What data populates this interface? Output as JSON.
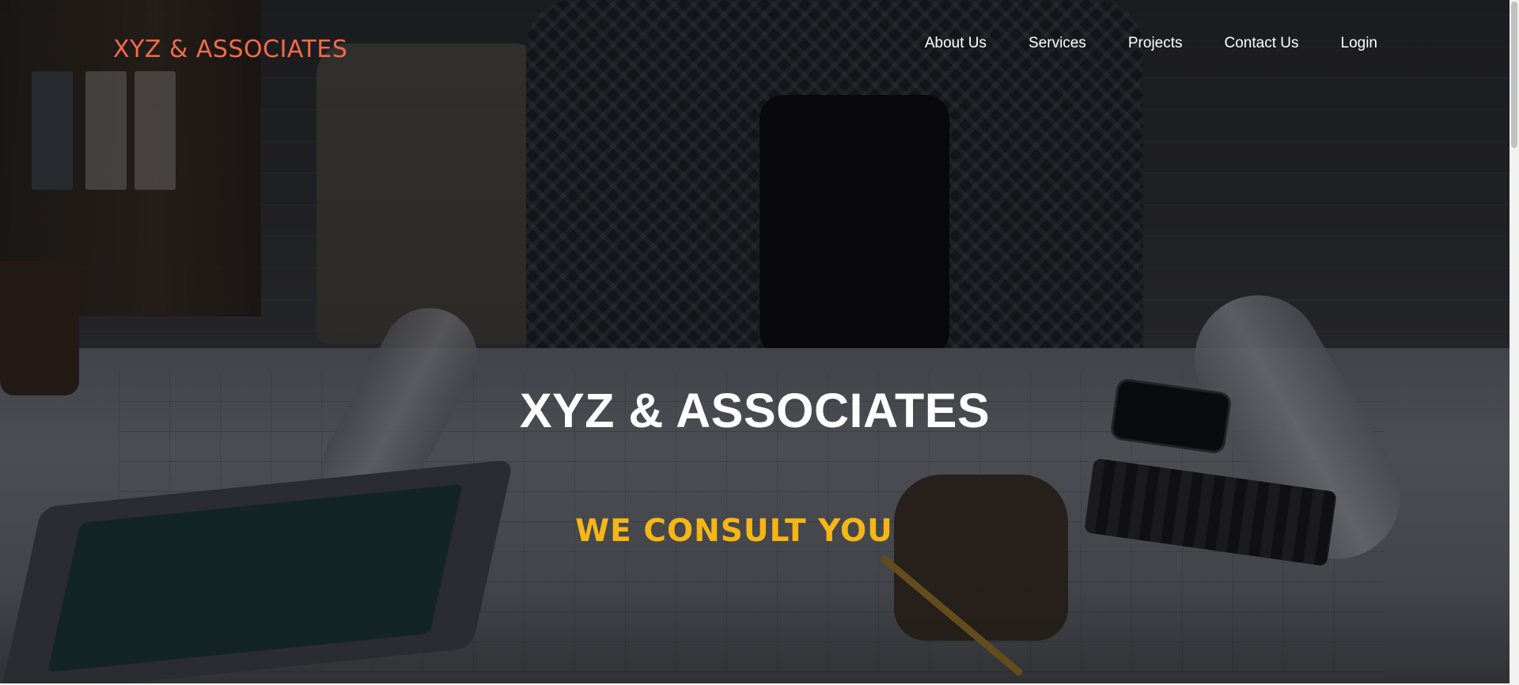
{
  "brand": {
    "logo_text": "XYZ & ASSOCIATES",
    "logo_color": "#f26b4a"
  },
  "nav": {
    "items": [
      {
        "label": "About Us"
      },
      {
        "label": "Services"
      },
      {
        "label": "Projects"
      },
      {
        "label": "Contact Us"
      },
      {
        "label": "Login"
      }
    ]
  },
  "hero": {
    "title": "XYZ & ASSOCIATES",
    "subtitle": "WE CONSULT YOU",
    "subtitle_color": "#f5b716",
    "background_image": "architect-at-desk-with-blueprints"
  }
}
